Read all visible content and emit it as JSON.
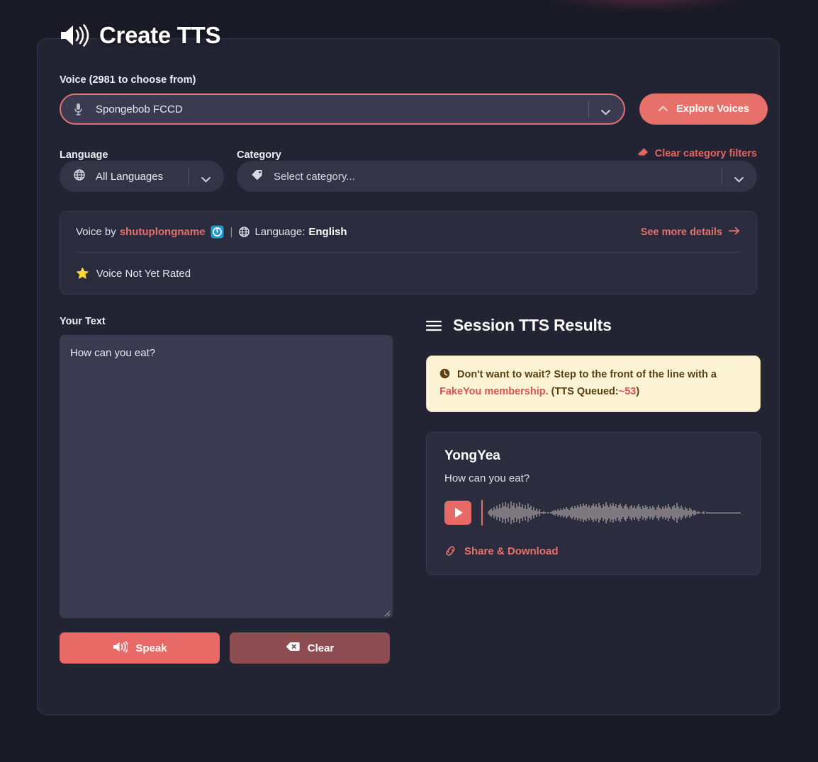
{
  "header": {
    "title": "Create TTS",
    "icon": "speaker-wave-icon"
  },
  "voice": {
    "label": "Voice (2981 to choose from)",
    "selected_value": "Spongebob FCCD",
    "icon": "microphone-icon",
    "dropdown_icon": "chevron-down-icon",
    "explore_button": {
      "label": "Explore Voices",
      "icon": "chevron-up-icon",
      "color": "#e8706b"
    }
  },
  "filters": {
    "language_label": "Language",
    "language_value": "All Languages",
    "language_icon": "globe-icon",
    "category_label": "Category",
    "category_placeholder": "Select category...",
    "category_icon": "tag-icon",
    "clear_filters_label": "Clear category filters",
    "clear_filters_icon": "eraser-icon",
    "clear_filters_color": "#e4645f"
  },
  "voice_info": {
    "by_prefix": "Voice by",
    "author": "shutuplongname",
    "author_badge_icon": "power-badge-icon",
    "separator": "|",
    "globe_icon": "globe-icon",
    "language_label": "Language:",
    "language_value": "English",
    "see_more_label": "See more details",
    "see_more_icon": "arrow-right-icon",
    "rating_star_icon": "star-icon",
    "rating_text": "Voice Not Yet Rated"
  },
  "editor": {
    "label": "Your Text",
    "value": "How can you eat?",
    "placeholder": "",
    "speak_button": {
      "label": "Speak",
      "icon": "speaker-wave-icon",
      "color": "#e86a66"
    },
    "clear_button": {
      "label": "Clear",
      "icon": "backspace-icon",
      "color": "#8e4d52"
    }
  },
  "results": {
    "title": "Session TTS Results",
    "title_icon": "list-menu-icon",
    "notice": {
      "icon": "clock-icon",
      "text_before": "Don't want to wait? Step to the front of the line with a",
      "link_text": "FakeYou membership.",
      "queue_prefix": "(TTS Queued:",
      "queue_count": "~53",
      "queue_suffix": ")",
      "bg_color": "#fdf3d5",
      "text_color": "#5b4010",
      "link_color": "#d9534f"
    },
    "cards": [
      {
        "voice_name": "YongYea",
        "text": "How can you eat?",
        "play_icon": "play-icon",
        "waveform_icon": "audio-waveform",
        "share_label": "Share & Download",
        "share_icon": "link-icon"
      }
    ]
  }
}
